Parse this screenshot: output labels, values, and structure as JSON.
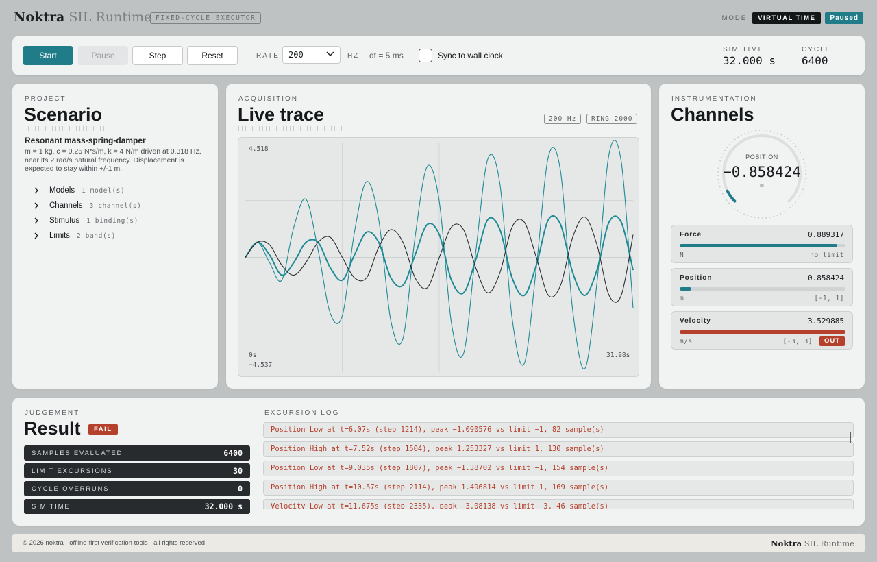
{
  "header": {
    "brand_main": "Noktra",
    "brand_sub": "SIL Runtime",
    "executor_badge": "FIXED-CYCLE EXECUTOR",
    "mode_label": "MODE",
    "mode_value": "VIRTUAL TIME",
    "state": "Paused",
    "accent_color": "#1f7c88",
    "alert_color": "#b5402c"
  },
  "controls": {
    "start_label": "Start",
    "pause_label": "Pause",
    "step_label": "Step",
    "reset_label": "Reset",
    "rate_label": "RATE",
    "rate_value": "200",
    "rate_unit": "HZ",
    "dt_text": "dt = 5 ms",
    "sync_label": "Sync to wall clock",
    "sync_checked": false,
    "sim_time_label": "SIM TIME",
    "sim_time_value": "32.000 s",
    "cycle_label": "CYCLE",
    "cycle_value": "6400"
  },
  "scenario": {
    "caption": "PROJECT",
    "title": "Scenario",
    "name": "Resonant mass-spring-damper",
    "description": "m = 1 kg, c = 0.25 N*s/m, k = 4 N/m driven at 0.318 Hz, near its 2 rad/s natural frequency. Displacement is expected to stay within +/-1 m.",
    "tree": [
      {
        "label": "Models",
        "count": "1 model(s)"
      },
      {
        "label": "Channels",
        "count": "3 channel(s)"
      },
      {
        "label": "Stimulus",
        "count": "1 binding(s)"
      },
      {
        "label": "Limits",
        "count": "2 band(s)"
      }
    ]
  },
  "trace": {
    "caption": "ACQUISITION",
    "title": "Live trace",
    "rate_tag": "200 Hz",
    "ring_tag": "RING 2000",
    "y_max_label": "4.518",
    "y_min_label": "−4.537",
    "x_start_label": "0s",
    "x_end_label": "31.98s"
  },
  "chart_data": {
    "type": "line",
    "x_range": [
      0,
      31.98
    ],
    "ylim": [
      -4.537,
      4.518
    ],
    "grid": true,
    "series": [
      {
        "color": "#1d8a96",
        "note_from_legend": "",
        "model": "velocity",
        "x": [
          0,
          1,
          2,
          3,
          4,
          5,
          6,
          7,
          8,
          9,
          10,
          11,
          12,
          13,
          14,
          15,
          16,
          17,
          18,
          19,
          20,
          21,
          22,
          23,
          24,
          25,
          26,
          27,
          28,
          29,
          30,
          31,
          31.98
        ],
        "y": [
          0.0,
          0.6,
          -0.2,
          -0.9,
          1.2,
          2.3,
          0.3,
          -2.2,
          -2.3,
          1.0,
          3.0,
          1.5,
          -2.5,
          -3.2,
          0.8,
          3.6,
          2.2,
          -2.6,
          -3.8,
          0.2,
          3.9,
          2.9,
          -2.4,
          -4.2,
          -0.4,
          4.0,
          3.4,
          -2.1,
          -4.4,
          -1.0,
          4.1,
          3.8,
          -2.0
        ]
      },
      {
        "color": "#1d8a96",
        "model": "position",
        "x": [
          0,
          1,
          2,
          3,
          4,
          5,
          6,
          7,
          8,
          9,
          10,
          11,
          12,
          13,
          14,
          15,
          16,
          17,
          18,
          19,
          20,
          21,
          22,
          23,
          24,
          25,
          26,
          27,
          28,
          29,
          30,
          31,
          31.98
        ],
        "y": [
          0.0,
          0.6,
          0.1,
          -0.7,
          -0.2,
          0.6,
          0.6,
          -0.4,
          -0.9,
          0.1,
          1.0,
          0.6,
          -0.8,
          -1.1,
          0.1,
          1.3,
          0.9,
          -0.9,
          -1.4,
          -0.1,
          1.5,
          1.1,
          -0.8,
          -1.5,
          -0.3,
          1.5,
          1.3,
          -0.6,
          -1.5,
          -0.5,
          1.4,
          1.4,
          -0.5
        ]
      },
      {
        "color": "#2a2d2f",
        "model": "force",
        "x": [
          0,
          1,
          2,
          3,
          4,
          5,
          6,
          7,
          8,
          9,
          10,
          11,
          12,
          13,
          14,
          15,
          16,
          17,
          18,
          19,
          20,
          21,
          22,
          23,
          24,
          25,
          26,
          27,
          28,
          29,
          30,
          31,
          31.98
        ],
        "y": [
          0.0,
          0.6,
          0.5,
          -0.3,
          -0.7,
          -0.2,
          0.6,
          0.8,
          0.0,
          -0.8,
          -0.8,
          0.4,
          1.1,
          0.6,
          -0.8,
          -1.2,
          0.0,
          1.2,
          1.1,
          -0.4,
          -1.4,
          -0.6,
          1.2,
          1.4,
          0.0,
          -1.5,
          -1.1,
          0.8,
          1.6,
          0.5,
          -1.5,
          -1.5,
          0.9
        ]
      }
    ]
  },
  "channels": {
    "caption": "INSTRUMENTATION",
    "title": "Channels",
    "gauge_label": "POSITION",
    "gauge_value": "−0.858424",
    "gauge_unit": "m",
    "gauge_fraction": 0.07,
    "meters": [
      {
        "name": "Force",
        "value": "0.889317",
        "unit": "N",
        "limit": "no limit",
        "fill_fraction": 0.95,
        "color": "#1f7c88"
      },
      {
        "name": "Position",
        "value": "−0.858424",
        "unit": "m",
        "limit": "[-1, 1]",
        "fill_fraction": 0.07,
        "color": "#1f7c88"
      },
      {
        "name": "Velocity",
        "value": "3.529885",
        "unit": "m/s",
        "limit": "[-3, 3]",
        "fill_fraction": 1.0,
        "color": "#b5402c",
        "out_label": "OUT"
      }
    ]
  },
  "result": {
    "caption": "JUDGEMENT",
    "title": "Result",
    "verdict": "FAIL",
    "stats": [
      {
        "label": "SAMPLES EVALUATED",
        "value": "6400"
      },
      {
        "label": "LIMIT EXCURSIONS",
        "value": "30"
      },
      {
        "label": "CYCLE OVERRUNS",
        "value": "0"
      },
      {
        "label": "SIM TIME",
        "value": "32.000 s"
      }
    ],
    "log_caption": "EXCURSION LOG",
    "log": [
      "Position Low at t=6.07s (step 1214), peak −1.090576 vs limit −1, 82 sample(s)",
      "Position High at t=7.52s (step 1504), peak 1.253327 vs limit 1, 130 sample(s)",
      "Position Low at t=9.035s (step 1807), peak −1.38702 vs limit −1, 154 sample(s)",
      "Position High at t=10.57s (step 2114), peak 1.496814 vs limit 1, 169 sample(s)",
      "Velocity Low at t=11.675s (step 2335), peak −3.08138 vs limit −3, 46 sample(s)"
    ]
  },
  "footer": {
    "copyright": "© 2026 noktra · offline-first verification tools · all rights reserved",
    "brand_main": "Noktra",
    "brand_sub": "SIL Runtime"
  }
}
